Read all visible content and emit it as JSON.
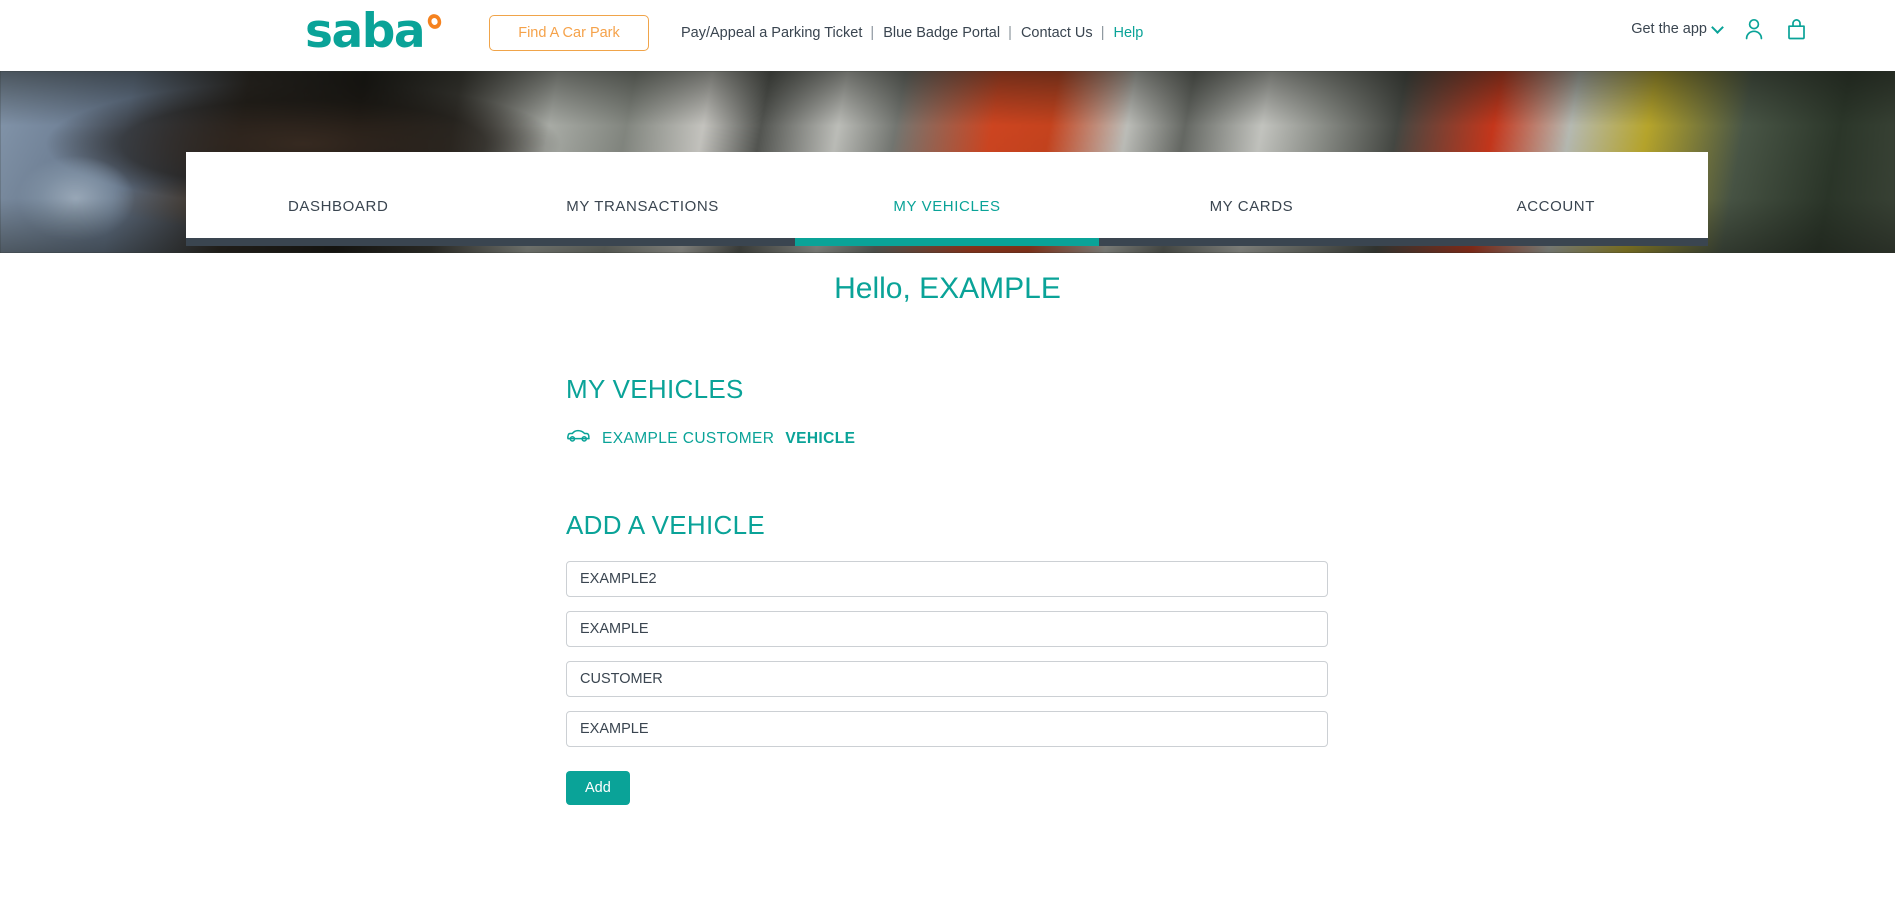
{
  "brand": {
    "logo_text": "saba",
    "teal": "#0aa398",
    "orange": "#f5821f",
    "slate": "#3a4550"
  },
  "header": {
    "find_car_park_label": "Find A Car Park",
    "links": [
      {
        "label": "Pay/Appeal a Parking Ticket",
        "highlight": false
      },
      {
        "label": "Blue Badge Portal",
        "highlight": false
      },
      {
        "label": "Contact Us",
        "highlight": false
      },
      {
        "label": "Help",
        "highlight": true
      }
    ],
    "separator": "|",
    "get_the_app_label": "Get the app",
    "account_icon": "user-icon",
    "basket_icon": "basket-icon",
    "chevron_icon": "chevron-down-icon"
  },
  "tabs": [
    {
      "label": "DASHBOARD",
      "active": false
    },
    {
      "label": "MY TRANSACTIONS",
      "active": false
    },
    {
      "label": "MY VEHICLES",
      "active": true
    },
    {
      "label": "MY CARDS",
      "active": false
    },
    {
      "label": "ACCOUNT",
      "active": false
    }
  ],
  "main": {
    "greeting": "Hello, EXAMPLE",
    "my_vehicles_heading": "MY VEHICLES",
    "vehicle": {
      "icon": "car-icon",
      "name_regular": "EXAMPLE CUSTOMER",
      "name_bold": "VEHICLE"
    },
    "add_vehicle_heading": "ADD A VEHICLE",
    "fields": [
      {
        "name": "vehicle-field-1",
        "value": "EXAMPLE2",
        "placeholder": "EXAMPLE2"
      },
      {
        "name": "vehicle-field-2",
        "value": "EXAMPLE",
        "placeholder": "EXAMPLE"
      },
      {
        "name": "vehicle-field-3",
        "value": "CUSTOMER",
        "placeholder": "CUSTOMER"
      },
      {
        "name": "vehicle-field-4",
        "value": "EXAMPLE",
        "placeholder": "EXAMPLE"
      }
    ],
    "add_button_label": "Add"
  }
}
